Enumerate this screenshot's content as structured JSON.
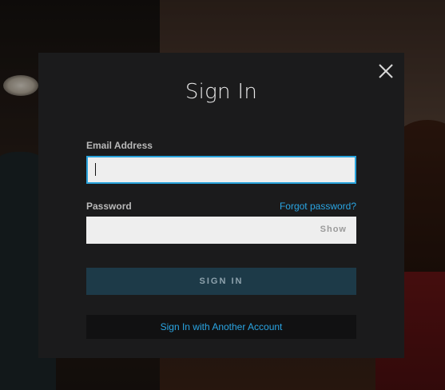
{
  "dialog": {
    "title": "Sign In",
    "email": {
      "label": "Email Address",
      "value": "",
      "focused": true
    },
    "password": {
      "label": "Password",
      "value": "",
      "forgot_link": "Forgot password?",
      "show_toggle": "Show"
    },
    "signin_button": "SIGN IN",
    "another_account_button": "Sign In with Another Account",
    "close_icon": "close-icon"
  },
  "colors": {
    "accent": "#29a3dc",
    "modal_bg": "#1b1b1c",
    "signin_bg": "#1d3a48",
    "input_bg": "#eeeeee"
  }
}
